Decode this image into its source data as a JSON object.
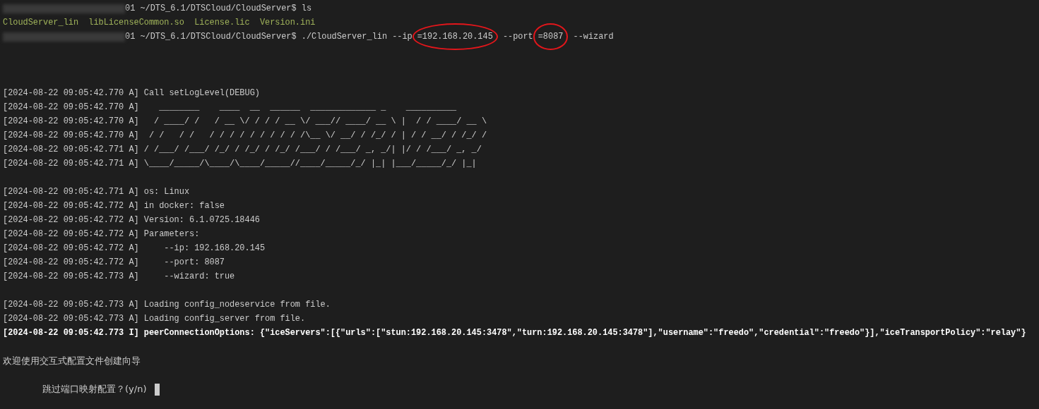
{
  "terminal": {
    "lines": [
      {
        "kind": "prompt",
        "redacted": true,
        "segments": [
          {
            "text": "01 ~/DTS_6.1/DTSCloud/CloudServer$ ls",
            "circled": false
          }
        ]
      },
      {
        "kind": "output",
        "text": "CloudServer_lin  libLicenseCommon.so  License.lic  Version.ini"
      },
      {
        "kind": "prompt",
        "redacted": true,
        "segments": [
          {
            "text": "01 ~/DTS_6.1/DTSCloud/CloudServer$ ./CloudServer_lin --ip",
            "circled": false
          },
          {
            "text": "=192.168.20.145",
            "circled": true
          },
          {
            "text": " --port",
            "circled": false
          },
          {
            "text": "=8087",
            "circled": true
          },
          {
            "text": " --wizard",
            "circled": false
          }
        ]
      },
      {
        "kind": "blank"
      },
      {
        "kind": "blank"
      },
      {
        "kind": "blank"
      },
      {
        "kind": "log",
        "bold": false,
        "text": "[2024-08-22 09:05:42.770 A] Call setLogLevel(DEBUG)"
      },
      {
        "kind": "log",
        "bold": false,
        "text": "[2024-08-22 09:05:42.770 A]    ________    ____  __  ______  _____________ _    __________"
      },
      {
        "kind": "log",
        "bold": false,
        "text": "[2024-08-22 09:05:42.770 A]   / ____/ /   / __ \\/ / / / __ \\/ ___// ____/ __ \\ |  / / ____/ __ \\"
      },
      {
        "kind": "log",
        "bold": false,
        "text": "[2024-08-22 09:05:42.770 A]  / /   / /   / / / / / / / / / /\\__ \\/ __/ / /_/ / | / / __/ / /_/ /"
      },
      {
        "kind": "log",
        "bold": false,
        "text": "[2024-08-22 09:05:42.771 A] / /___/ /___/ /_/ / /_/ / /_/ /___/ / /___/ _, _/| |/ / /___/ _, _/"
      },
      {
        "kind": "log",
        "bold": false,
        "text": "[2024-08-22 09:05:42.771 A] \\____/_____/\\____/\\____/_____//____/_____/_/ |_| |___/_____/_/ |_|"
      },
      {
        "kind": "blank"
      },
      {
        "kind": "log",
        "bold": false,
        "text": "[2024-08-22 09:05:42.771 A] os: Linux"
      },
      {
        "kind": "log",
        "bold": false,
        "text": "[2024-08-22 09:05:42.772 A] in docker: false"
      },
      {
        "kind": "log",
        "bold": false,
        "text": "[2024-08-22 09:05:42.772 A] Version: 6.1.0725.18446"
      },
      {
        "kind": "log",
        "bold": false,
        "text": "[2024-08-22 09:05:42.772 A] Parameters:"
      },
      {
        "kind": "log",
        "bold": false,
        "text": "[2024-08-22 09:05:42.772 A]     --ip: 192.168.20.145"
      },
      {
        "kind": "log",
        "bold": false,
        "text": "[2024-08-22 09:05:42.772 A]     --port: 8087"
      },
      {
        "kind": "log",
        "bold": false,
        "text": "[2024-08-22 09:05:42.773 A]     --wizard: true"
      },
      {
        "kind": "blank"
      },
      {
        "kind": "log",
        "bold": false,
        "text": "[2024-08-22 09:05:42.773 A] Loading config_nodeservice from file."
      },
      {
        "kind": "log",
        "bold": false,
        "text": "[2024-08-22 09:05:42.773 A] Loading config_server from file."
      },
      {
        "kind": "log",
        "bold": true,
        "text": "[2024-08-22 09:05:42.773 I] peerConnectionOptions: {\"iceServers\":[{\"urls\":[\"stun:192.168.20.145:3478\",\"turn:192.168.20.145:3478\"],\"username\":\"freedo\",\"credential\":\"freedo\"}],\"iceTransportPolicy\":\"relay\"}"
      },
      {
        "kind": "blank"
      },
      {
        "kind": "text",
        "text": "欢迎使用交互式配置文件创建向导"
      },
      {
        "kind": "blank"
      },
      {
        "kind": "input",
        "cursor": true,
        "text": "跳过端口映射配置？(y/n)"
      }
    ]
  }
}
